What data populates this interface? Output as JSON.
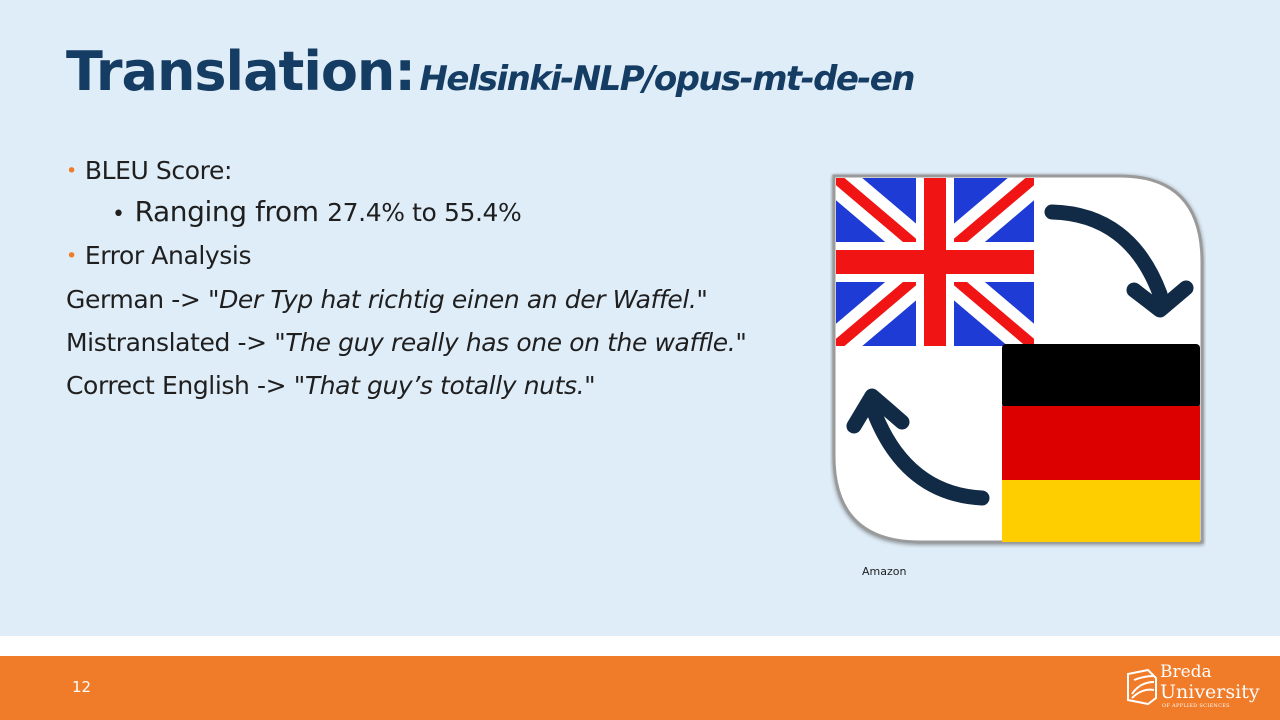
{
  "title": {
    "main": "Translation:",
    "model": "Helsinki-NLP/opus-mt-de-en"
  },
  "bullets": {
    "bleu_label": "BLEU Score:",
    "range_prefix": "Ranging from ",
    "range_values": "27.4% to 55.4%",
    "error_label": "Error Analysis"
  },
  "examples": {
    "german_label": "German -> \"",
    "german_text": "Der Typ hat richtig einen an der Waffel.\"",
    "mis_label": "Mistranslated -> ",
    "mis_text": "\"The guy really has one on the waffle.",
    "mis_close": "\"",
    "correct_label": "Correct English -> ",
    "correct_text": "\"That guy’s totally nuts.\""
  },
  "image": {
    "caption": "Amazon",
    "colors": {
      "uk_blue": "#1f3bd6",
      "uk_red": "#f01414",
      "de_black": "#000000",
      "de_red": "#dd0000",
      "de_gold": "#ffce00",
      "arrow": "#112a45"
    }
  },
  "footer": {
    "page_number": "12",
    "logo_line1": "Breda",
    "logo_line2": "University",
    "logo_line3": "OF APPLIED SCIENCES"
  },
  "colors": {
    "title": "#153c63",
    "accent": "#f07b28",
    "background": "#dfedf8"
  }
}
